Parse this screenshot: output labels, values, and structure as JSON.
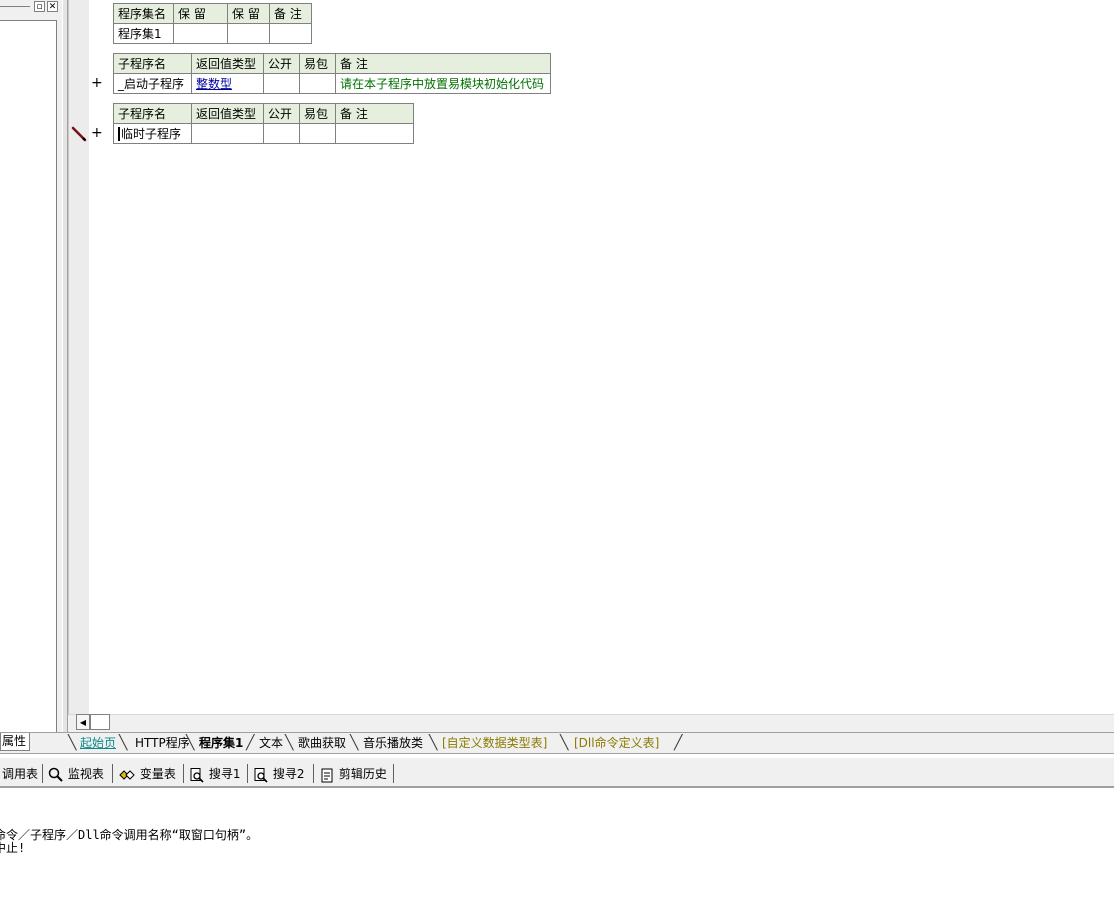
{
  "assembly_table": {
    "headers": [
      "程序集名",
      "保 留",
      "保 留",
      "备 注"
    ],
    "row": [
      "程序集1",
      "",
      "",
      ""
    ]
  },
  "sub_table_1": {
    "headers": [
      "子程序名",
      "返回值类型",
      "公开",
      "易包",
      "备 注"
    ],
    "name": "_启动子程序",
    "return_type": "整数型",
    "public": "",
    "pkg": "",
    "remark": "请在本子程序中放置易模块初始化代码"
  },
  "sub_table_2": {
    "headers": [
      "子程序名",
      "返回值类型",
      "公开",
      "易包",
      "备 注"
    ],
    "name": "临时子程序",
    "return_type": "",
    "public": "",
    "pkg": "",
    "remark": ""
  },
  "expand_symbol": "+",
  "left_panel": {
    "tab_label": "属性"
  },
  "tabs": [
    {
      "label": "起始页",
      "color": "#0a8a8a"
    },
    {
      "label": "HTTP程序",
      "color": "#000000"
    },
    {
      "label": "程序集1",
      "color": "#000000",
      "active": true
    },
    {
      "label": "文本",
      "color": "#000000"
    },
    {
      "label": "歌曲获取",
      "color": "#000000"
    },
    {
      "label": "音乐播放类",
      "color": "#000000"
    },
    {
      "label": "[自定义数据类型表]",
      "color": "#8a7a00"
    },
    {
      "label": "[Dll命令定义表]",
      "color": "#8a7a00"
    }
  ],
  "toolbar": {
    "call_table": "调用表",
    "watch_table": "监视表",
    "var_table": "变量表",
    "search1": "搜寻1",
    "search2": "搜寻2",
    "clip_history": "剪辑历史"
  },
  "output": {
    "line1": "命令／子程序／Dll命令调用名称“取窗口句柄”。",
    "line2": "中止!"
  },
  "icons": {
    "edit_marker": "pencil-icon",
    "scroll_left": "arrow-left-icon",
    "watch": "magnifier-icon",
    "var": "variables-icon",
    "search": "search-doc-icon",
    "clip": "clipboard-icon"
  }
}
